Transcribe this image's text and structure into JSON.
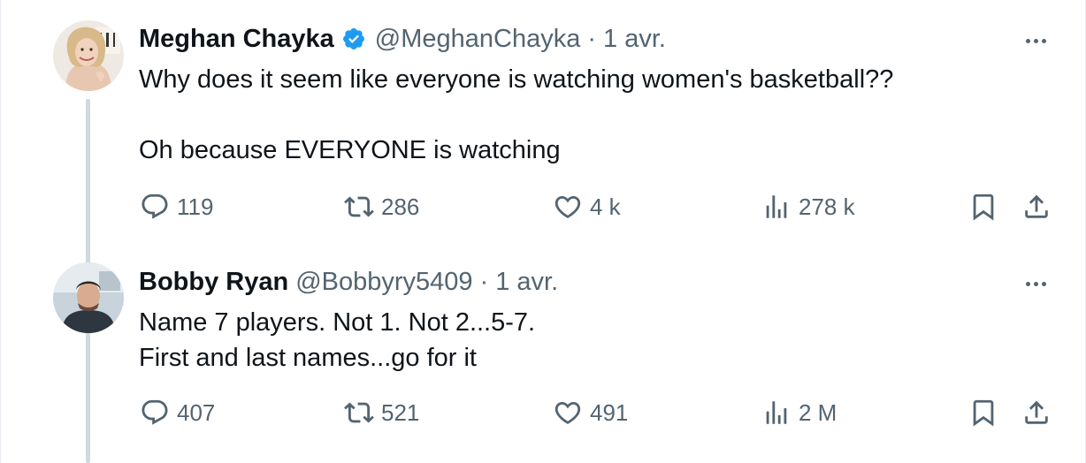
{
  "tweets": [
    {
      "author": {
        "name": "Meghan Chayka",
        "handle": "@MeghanChayka",
        "verified": true,
        "avatar_icon": "profile-photo"
      },
      "separator": "·",
      "time": "1 avr.",
      "text": [
        "Why does it seem like everyone is watching women's basketball??",
        "Oh because EVERYONE is watching"
      ],
      "stats": {
        "replies": "119",
        "retweets": "286",
        "likes": "4 k",
        "views": "278 k"
      }
    },
    {
      "author": {
        "name": "Bobby Ryan",
        "handle": "@Bobbyry5409",
        "verified": false,
        "avatar_icon": "profile-photo"
      },
      "separator": "·",
      "time": "1 avr.",
      "text": [
        "Name 7 players. Not 1. Not 2...5-7.",
        "First and last names...go for it"
      ],
      "stats": {
        "replies": "407",
        "retweets": "521",
        "likes": "491",
        "views": "2 M"
      }
    }
  ],
  "icons": {
    "reply": "reply-icon",
    "retweet": "retweet-icon",
    "like": "heart-icon",
    "views": "views-icon",
    "bookmark": "bookmark-icon",
    "share": "share-icon",
    "more": "more-icon",
    "verified": "verified-badge-icon"
  },
  "colors": {
    "text_primary": "#0f1419",
    "text_secondary": "#536471",
    "verified_blue": "#1d9bf0",
    "thread_line": "#cfd9de"
  }
}
